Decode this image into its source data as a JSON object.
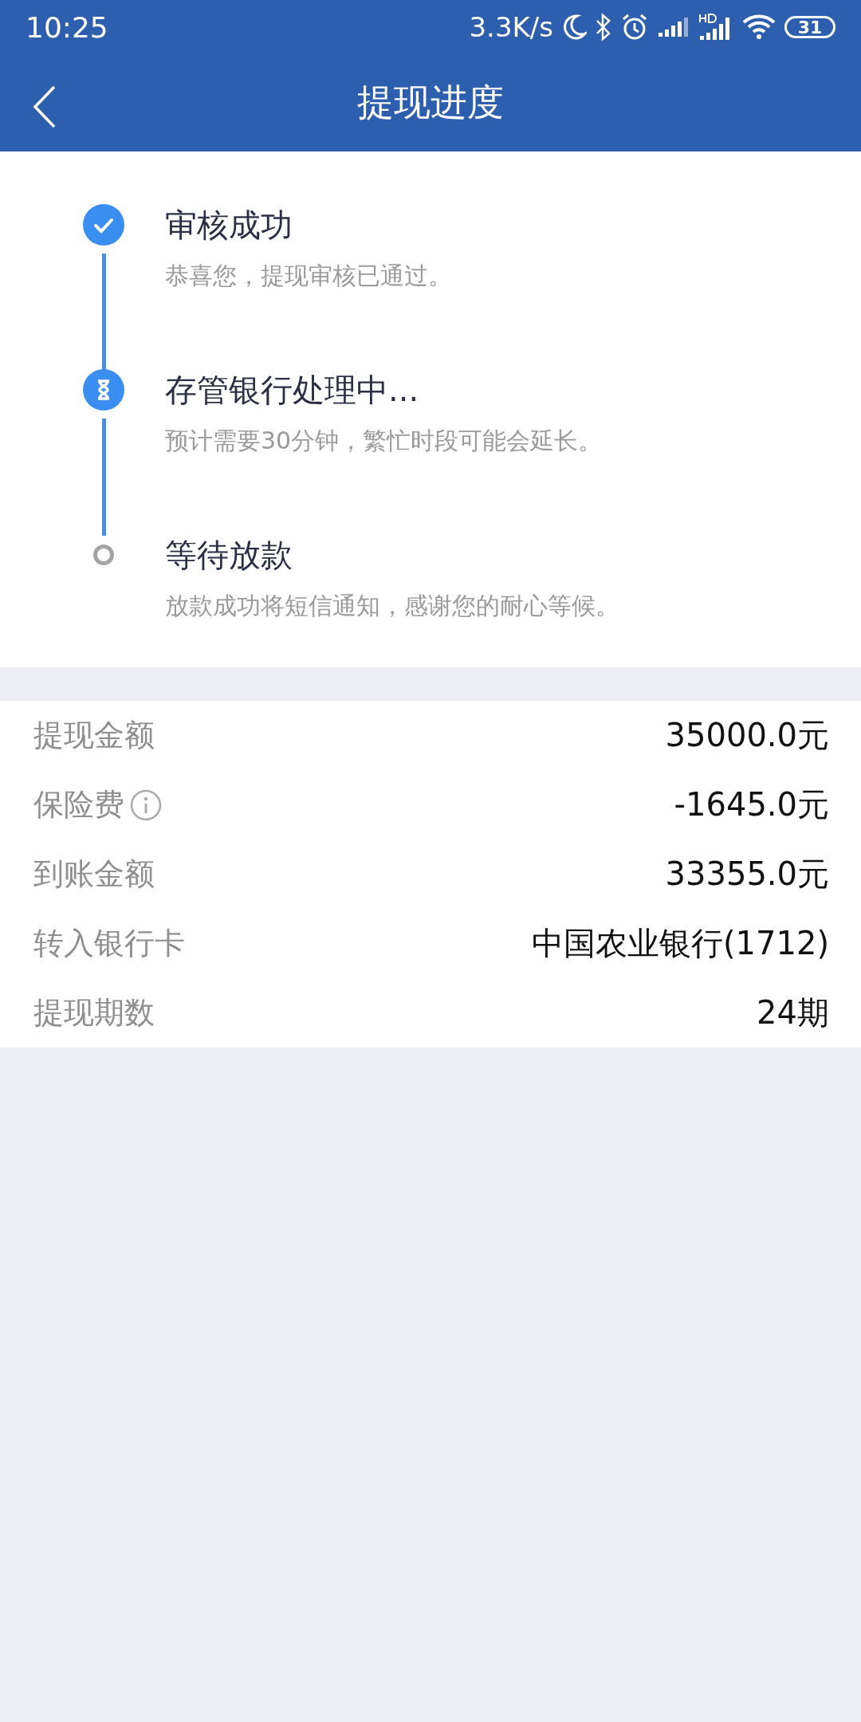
{
  "status_bar": {
    "time": "10:25",
    "speed": "3.3K/s",
    "battery": "31"
  },
  "nav": {
    "title": "提现进度"
  },
  "steps": [
    {
      "kind": "done",
      "title": "审核成功",
      "description": "恭喜您，提现审核已通过。"
    },
    {
      "kind": "active",
      "title": "存管银行处理中...",
      "description": "预计需要30分钟，繁忙时段可能会延长。"
    },
    {
      "kind": "pending",
      "title": "等待放款",
      "description": "放款成功将短信通知，感谢您的耐心等候。"
    }
  ],
  "details": [
    {
      "label": "提现金额",
      "value": "35000.0元",
      "info": false
    },
    {
      "label": "保险费",
      "value": "-1645.0元",
      "info": true
    },
    {
      "label": "到账金额",
      "value": "33355.0元",
      "info": false
    },
    {
      "label": "转入银行卡",
      "value": "中国农业银行(1712)",
      "info": false
    },
    {
      "label": "提现期数",
      "value": "24期",
      "info": false
    }
  ]
}
